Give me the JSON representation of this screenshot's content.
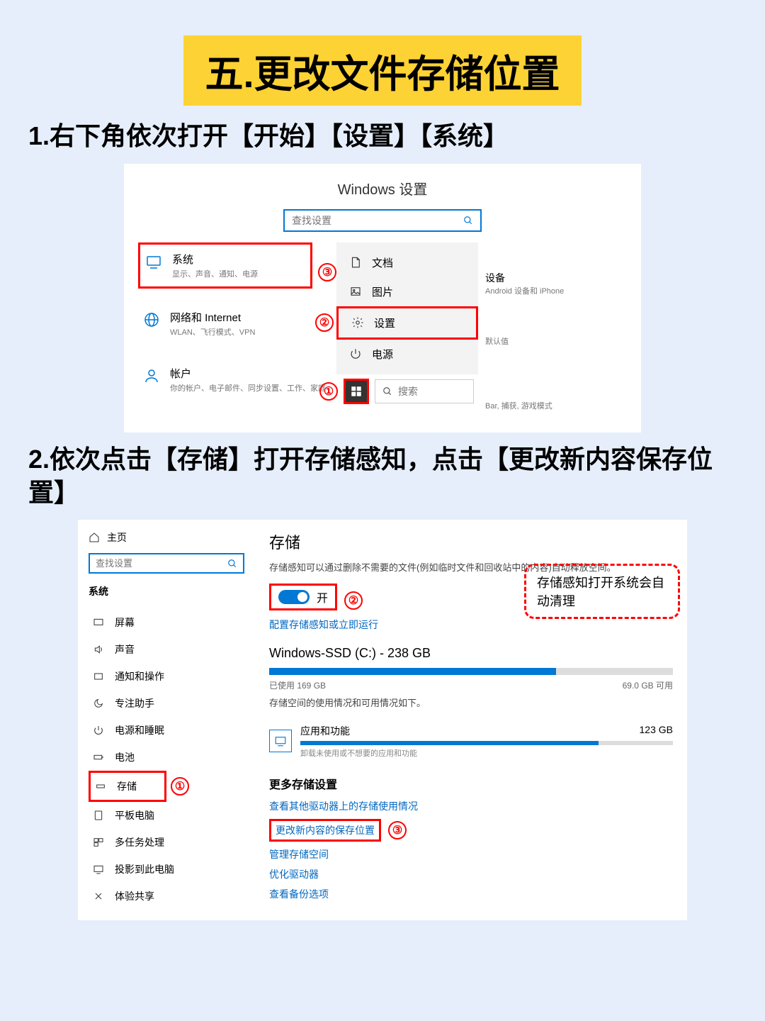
{
  "banner": "五.更改文件存储位置",
  "step1": "1.右下角依次打开【开始】【设置】【系统】",
  "step2": "2.依次点击【存储】打开存储感知，点击【更改新内容保存位置】",
  "ws": {
    "title": "Windows 设置",
    "search_placeholder": "查找设置",
    "tiles": {
      "system": {
        "label": "系统",
        "desc": "显示、声音、通知、电源"
      },
      "network": {
        "label": "网络和 Internet",
        "desc": "WLAN、飞行模式、VPN"
      },
      "account": {
        "label": "帐户",
        "desc": "你的帐户、电子邮件、同步设置、工作、家庭"
      }
    },
    "menu": {
      "docs": "文档",
      "pics": "图片",
      "settings": "设置",
      "power": "电源"
    },
    "search_bar": "搜索",
    "right_devices": "设备",
    "right_devices_desc": "Android 设备和 iPhone",
    "right_default": "默认值",
    "right_bar": "Bar, 捕获, 游戏模式"
  },
  "marks": {
    "one": "①",
    "two": "②",
    "three": "③"
  },
  "sp": {
    "home": "主页",
    "search_placeholder": "查找设置",
    "section": "系统",
    "nav": {
      "display": "屏幕",
      "sound": "声音",
      "notif": "通知和操作",
      "focus": "专注助手",
      "power": "电源和睡眠",
      "battery": "电池",
      "storage": "存储",
      "tablet": "平板电脑",
      "multi": "多任务处理",
      "project": "投影到此电脑",
      "share": "体验共享"
    },
    "title": "存储",
    "desc": "存储感知可以通过删除不需要的文件(例如临时文件和回收站中的内容)自动释放空间。",
    "toggle_label": "开",
    "config_link": "配置存储感知或立即运行",
    "note": "存储感知打开系统会自动清理",
    "disk_name": "Windows-SSD (C:) - 238 GB",
    "disk_used": "已使用 169 GB",
    "disk_free": "69.0 GB 可用",
    "usage_desc": "存储空间的使用情况和可用情况如下。",
    "app_label": "应用和功能",
    "app_size": "123 GB",
    "app_desc": "卸载未使用或不想要的应用和功能",
    "more_title": "更多存储设置",
    "links": {
      "other_drives": "查看其他驱动器上的存储使用情况",
      "change_save": "更改新内容的保存位置",
      "manage": "管理存储空间",
      "optimize": "优化驱动器",
      "backup": "查看备份选项"
    }
  }
}
